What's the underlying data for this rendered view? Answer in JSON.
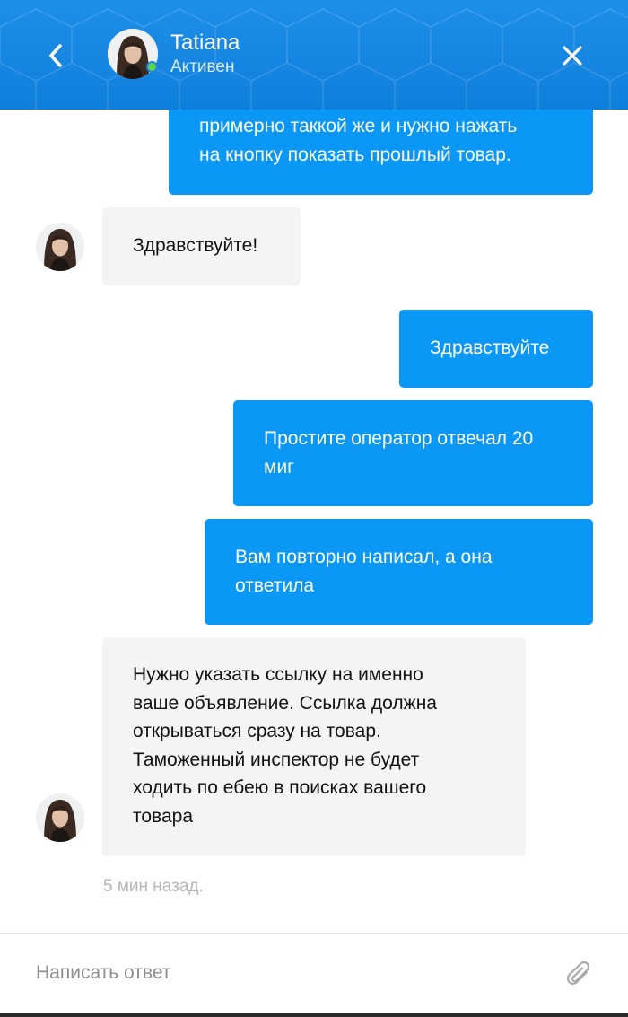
{
  "header": {
    "contact_name": "Tatiana",
    "status": "Активен",
    "back_icon": "chevron-left-icon",
    "close_icon": "close-icon",
    "brand_color": "#1787e4",
    "online_color": "#5fd64a"
  },
  "messages": [
    {
      "direction": "out",
      "lines": [
        "примерно таккой же и нужно нажать",
        "на кнопку показать прошлый товар."
      ]
    },
    {
      "direction": "in",
      "lines": [
        "Здравствуйте!"
      ]
    },
    {
      "direction": "out",
      "lines": [
        "Здравствуйте"
      ]
    },
    {
      "direction": "out",
      "lines": [
        "Простите оператор отвечал 20",
        "миг"
      ]
    },
    {
      "direction": "out",
      "lines": [
        "Вам повторно написал, а она",
        "ответила"
      ]
    },
    {
      "direction": "in",
      "lines": [
        "Нужно указать ссылку на именно",
        "ваше объявление. Ссылка должна",
        "открываться сразу на товар.",
        "Таможенный инспектор не будет",
        "ходить по ебею в поисках вашего",
        "товара"
      ]
    }
  ],
  "timestamp": "5 мин назад.",
  "composer": {
    "placeholder": "Написать ответ",
    "attach_icon": "paperclip-icon"
  },
  "colors": {
    "outgoing_bubble": "#0a97f5",
    "incoming_bubble": "#f4f4f4"
  }
}
